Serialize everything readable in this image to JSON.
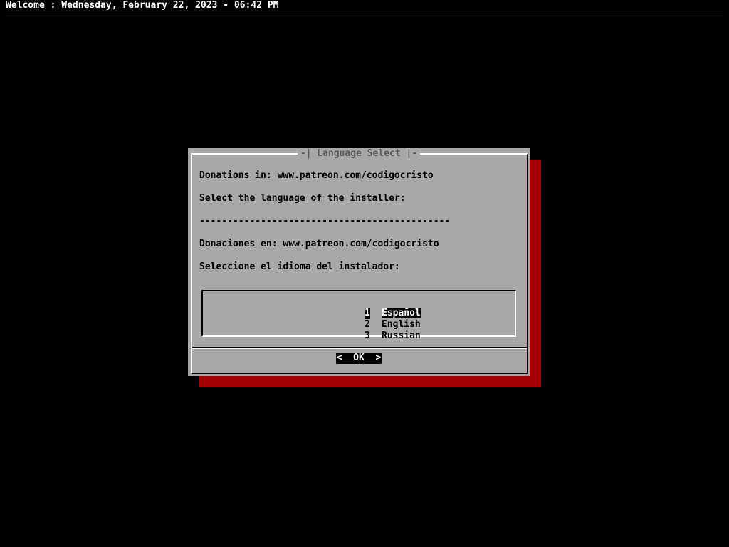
{
  "backtitle": "Welcome : Wednesday, February 22, 2023 - 06:42 PM",
  "dialog": {
    "title": "-| Language Select |-",
    "lines": [
      "Donations in: www.patreon.com/codigocristo",
      "Select the language of the installer:",
      "---------------------------------------------",
      "Donaciones en: www.patreon.com/codigocristo",
      "Seleccione el idioma del instalador:"
    ],
    "menu": {
      "items": [
        {
          "tag": "1",
          "label": "Español",
          "selected": true
        },
        {
          "tag": "2",
          "label": "English",
          "selected": false
        },
        {
          "tag": "3",
          "label": "Russian",
          "selected": false
        }
      ]
    },
    "ok_button": "<  OK  >"
  },
  "colors": {
    "screen_background": "#000000",
    "dialog_background": "#a8a8a8",
    "dialog_shadow": "#a80000",
    "title_text": "#585858",
    "highlight_background": "#000000",
    "highlight_text": "#ffffff"
  }
}
